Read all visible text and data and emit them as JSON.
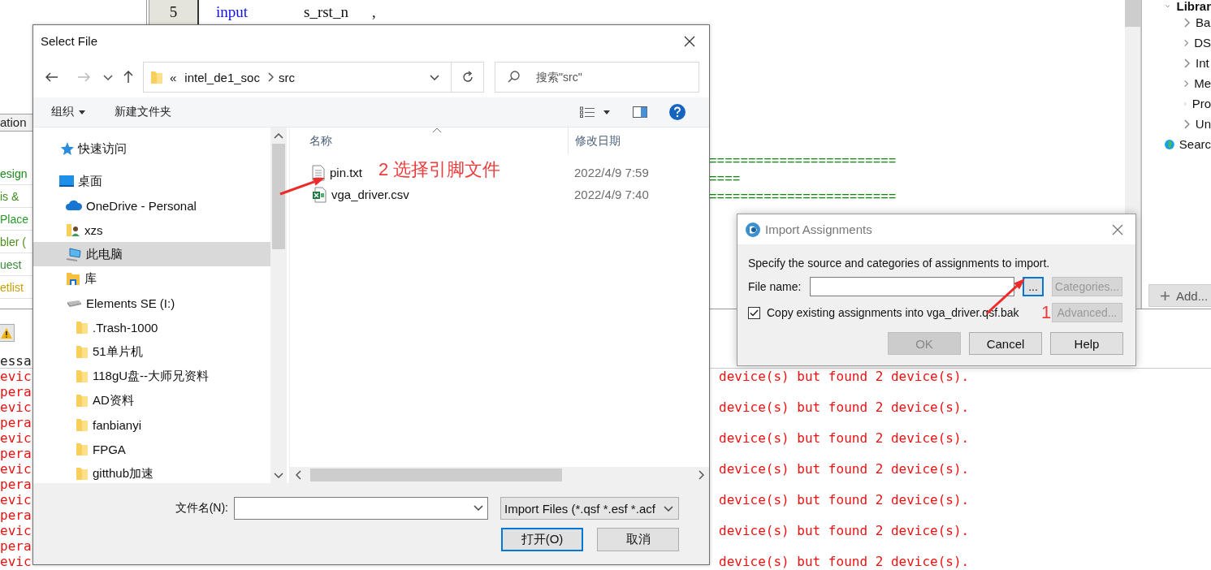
{
  "editor": {
    "line_number": "5",
    "code": [
      {
        "kind": "keyword",
        "text": "input"
      },
      {
        "kind": "plain",
        "text": "s_rst_n"
      },
      {
        "kind": "plain",
        "text": ","
      }
    ],
    "comment_lines": [
      "========================",
      "====",
      "========================"
    ]
  },
  "left_panel": {
    "tab": "ation",
    "tasks": [
      {
        "label": "esign",
        "color": "#1a8a1a"
      },
      {
        "label": "is &",
        "color": "#3b8d1f"
      },
      {
        "label": "Place",
        "color": "#2a9a2a"
      },
      {
        "label": "bler (",
        "color": "#4d8f1a"
      },
      {
        "label": "uest",
        "color": "#3a8a3a"
      },
      {
        "label": "etlist",
        "color": "#c8a000"
      }
    ]
  },
  "library_panel": {
    "title": "Librar",
    "items": [
      "Ba",
      "DS",
      "Int",
      "Me",
      "Pro",
      "Un"
    ],
    "search": "Searc",
    "add_button": "Add..."
  },
  "messages": {
    "column": "essa",
    "rows": [
      {
        "start": "evic",
        "end": "device(s) but found 2 device(s)."
      },
      {
        "start": "pera"
      },
      {
        "start": "evic",
        "end": "device(s) but found 2 device(s)."
      },
      {
        "start": "pera"
      },
      {
        "start": "evic",
        "end": "device(s) but found 2 device(s)."
      },
      {
        "start": "pera"
      },
      {
        "start": "evic",
        "end": "device(s) but found 2 device(s)."
      },
      {
        "start": "pera"
      },
      {
        "start": "evic",
        "end": "device(s) but found 2 device(s)."
      },
      {
        "start": "pera"
      },
      {
        "start": "evic",
        "end": "device(s) but found 2 device(s)."
      },
      {
        "start": "pera"
      },
      {
        "start": "evic",
        "end": "device(s) but found 2 device(s)."
      }
    ]
  },
  "select_file": {
    "title": "Select File",
    "address": {
      "overflow": "«",
      "segments": [
        "intel_de1_soc",
        "src"
      ]
    },
    "search": {
      "placeholder": "搜索\"src\""
    },
    "commands": {
      "organize": "组织",
      "new_folder": "新建文件夹"
    },
    "nav_items": [
      {
        "label": "快速访问",
        "kind": "star",
        "selected": false
      },
      {
        "label": "桌面",
        "kind": "desktop",
        "selected": false,
        "children": [
          {
            "label": "OneDrive - Personal",
            "kind": "cloud",
            "selected": false
          },
          {
            "label": "xzs",
            "kind": "user",
            "selected": false
          },
          {
            "label": "此电脑",
            "kind": "computer",
            "selected": true
          },
          {
            "label": "库",
            "kind": "library",
            "selected": false
          },
          {
            "label": "Elements SE (I:)",
            "kind": "drive",
            "selected": false,
            "children": [
              {
                "label": ".Trash-1000",
                "kind": "folder",
                "selected": false
              },
              {
                "label": "51单片机",
                "kind": "folder",
                "selected": false
              },
              {
                "label": "118gU盘--大师兄资料",
                "kind": "folder",
                "selected": false
              },
              {
                "label": "AD资料",
                "kind": "folder",
                "selected": false
              },
              {
                "label": "fanbianyi",
                "kind": "folder",
                "selected": false
              },
              {
                "label": "FPGA",
                "kind": "folder",
                "selected": false
              },
              {
                "label": "gitthub加速",
                "kind": "folder",
                "selected": false
              }
            ]
          }
        ]
      }
    ],
    "columns": [
      "名称",
      "修改日期"
    ],
    "files": [
      {
        "name": "pin.txt",
        "kind": "text",
        "date": "2022/4/9 7:59",
        "selected": false
      },
      {
        "name": "vga_driver.csv",
        "kind": "sheet",
        "date": "2022/4/9 7:40",
        "selected": false
      }
    ],
    "file_name_label": "文件名(N):",
    "filter": "Import Files (*.qsf *.esf *.acf",
    "buttons": [
      {
        "label": "打开(O)",
        "default": true
      },
      {
        "label": "取消",
        "default": false
      }
    ]
  },
  "import_dialog": {
    "title": "Import Assignments",
    "instruction": "Specify the source and categories of assignments to import.",
    "file_label": "File name:",
    "browse": {
      "label": "...",
      "focused": true
    },
    "categories": {
      "label": "Categories...",
      "disabled": true
    },
    "copy": {
      "label": "Copy existing assignments into vga_driver.qsf.bak",
      "checked": true
    },
    "advanced": {
      "label": "Advanced...",
      "disabled": true
    },
    "buttons": [
      {
        "label": "OK",
        "disabled": true
      },
      {
        "label": "Cancel",
        "disabled": false
      },
      {
        "label": "Help",
        "disabled": false
      }
    ]
  },
  "annotations": [
    {
      "text": "2 选择引脚文件"
    },
    {
      "text": "1"
    }
  ]
}
